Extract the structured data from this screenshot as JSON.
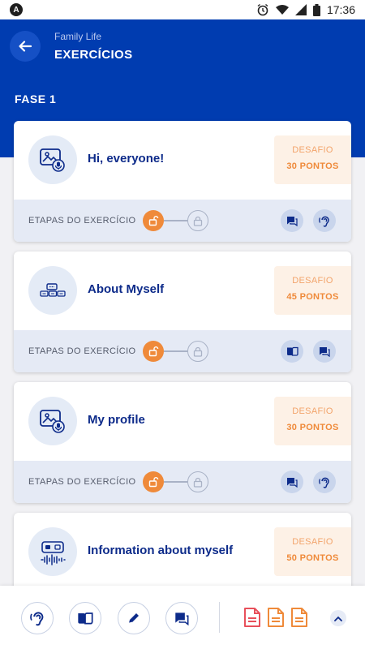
{
  "status_bar": {
    "time": "17:36",
    "app_badge": "A"
  },
  "header": {
    "subtitle": "Family Life",
    "title": "EXERCÍCIOS",
    "phase": "FASE 1"
  },
  "labels": {
    "challenge": "DESAFIO",
    "steps": "ETAPAS DO EXERCÍCIO"
  },
  "exercises": [
    {
      "title": "Hi, everyone!",
      "points": "30 PONTOS",
      "icon": "picture-microphone-icon",
      "actions": [
        "chat-icon",
        "listen-icon"
      ]
    },
    {
      "title": "About Myself",
      "points": "45 PONTOS",
      "icon": "words-blocks-icon",
      "actions": [
        "book-icon",
        "chat-icon"
      ]
    },
    {
      "title": "My profile",
      "points": "30 PONTOS",
      "icon": "picture-microphone-icon",
      "actions": [
        "chat-icon",
        "listen-icon"
      ]
    },
    {
      "title": "Information about myself",
      "points": "50 PONTOS",
      "icon": "audio-wave-icon",
      "actions": []
    }
  ],
  "bottom_bar": {
    "buttons": [
      "listen-icon",
      "book-icon",
      "pencil-icon",
      "chat-icon"
    ],
    "documents": [
      {
        "icon": "document-icon",
        "color": "#e8505b"
      },
      {
        "icon": "document-icon",
        "color": "#ef8a3a"
      },
      {
        "icon": "document-icon",
        "color": "#ef8a3a"
      }
    ]
  },
  "colors": {
    "primary": "#003cb0",
    "accent": "#ef8a3a",
    "title": "#0d2b8a"
  }
}
